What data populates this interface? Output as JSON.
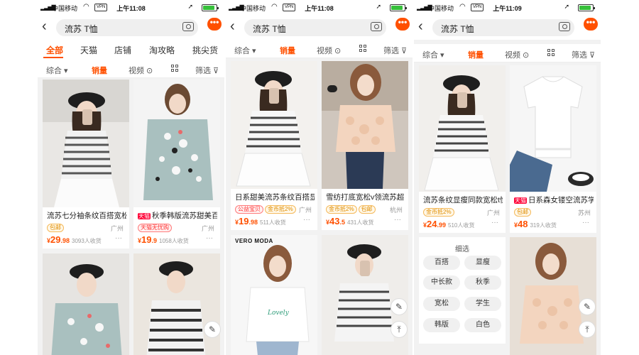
{
  "screens": [
    {
      "status": {
        "carrier": "中国移动",
        "vpn": "VPN",
        "time": "上午11:08"
      },
      "search": {
        "query": "流苏 T恤"
      },
      "tabs": [
        "全部",
        "天猫",
        "店铺",
        "淘攻略",
        "挑尖货"
      ],
      "sort": {
        "comprehensive": "综合",
        "sales": "销量",
        "video": "视频",
        "filter": "筛选"
      },
      "products": [
        {
          "title": "流苏七分袖条纹百搭宽松",
          "tag1": "包邮",
          "tag2": "",
          "city": "广州",
          "price_main": "29",
          "price_dec": ".98",
          "sold": "3093人收货"
        },
        {
          "tmall": "天猫",
          "title": "秋季韩版流苏甜美百",
          "tag1": "天猫无忧购",
          "tag2": "",
          "city": "广州",
          "price_main": "19",
          "price_dec": ".9",
          "sold": "1058人收货"
        }
      ]
    },
    {
      "status": {
        "carrier": "中国移动",
        "vpn": "VPN",
        "time": "上午11:08"
      },
      "search": {
        "query": "流苏 T恤"
      },
      "sort": {
        "comprehensive": "综合",
        "sales": "销量",
        "video": "视频",
        "filter": "筛选"
      },
      "products": [
        {
          "title": "日系甜美流苏条纹百搭显",
          "tag1": "公益宝贝",
          "tag2": "金币抵2%",
          "city": "广州",
          "price_main": "19",
          "price_dec": ".98",
          "sold": "511人收货"
        },
        {
          "title": "雪纺打底宽松v领流苏超",
          "tag1": "金币抵2%",
          "tag2": "包邮",
          "city": "杭州",
          "price_main": "43",
          "price_dec": ".5",
          "sold": "431人收货"
        }
      ],
      "brand": "VERO MODA"
    },
    {
      "status": {
        "carrier": "中国移动",
        "vpn": "VPN",
        "time": "上午11:09"
      },
      "search": {
        "query": "流苏 T恤"
      },
      "sort": {
        "comprehensive": "综合",
        "sales": "销量",
        "video": "视频",
        "filter": "筛选"
      },
      "products": [
        {
          "title": "流苏条纹显瘦同款宽松t恤",
          "tag1": "金币抵2%",
          "tag2": "",
          "city": "广州",
          "price_main": "24",
          "price_dec": ".99",
          "sold": "510人收货"
        },
        {
          "tmall": "天猫",
          "title": "日系森女镂空流苏学",
          "tag1": "包邮",
          "tag2": "",
          "city": "苏州",
          "price_main": "48",
          "price_dec": "",
          "sold": "319人收货"
        }
      ],
      "refine": {
        "title": "细选",
        "chips": [
          "百搭",
          "显瘦",
          "中长款",
          "秋季",
          "宽松",
          "学生",
          "韩版",
          "白色"
        ]
      }
    }
  ],
  "currency": "¥",
  "icons": {
    "back": "chevron-left-icon",
    "camera": "camera-icon",
    "more": "more-dots-icon",
    "edit": "edit-icon",
    "top": "back-to-top-icon"
  },
  "colors": {
    "accent": "#ff5000",
    "tmall": "#ff0036"
  }
}
